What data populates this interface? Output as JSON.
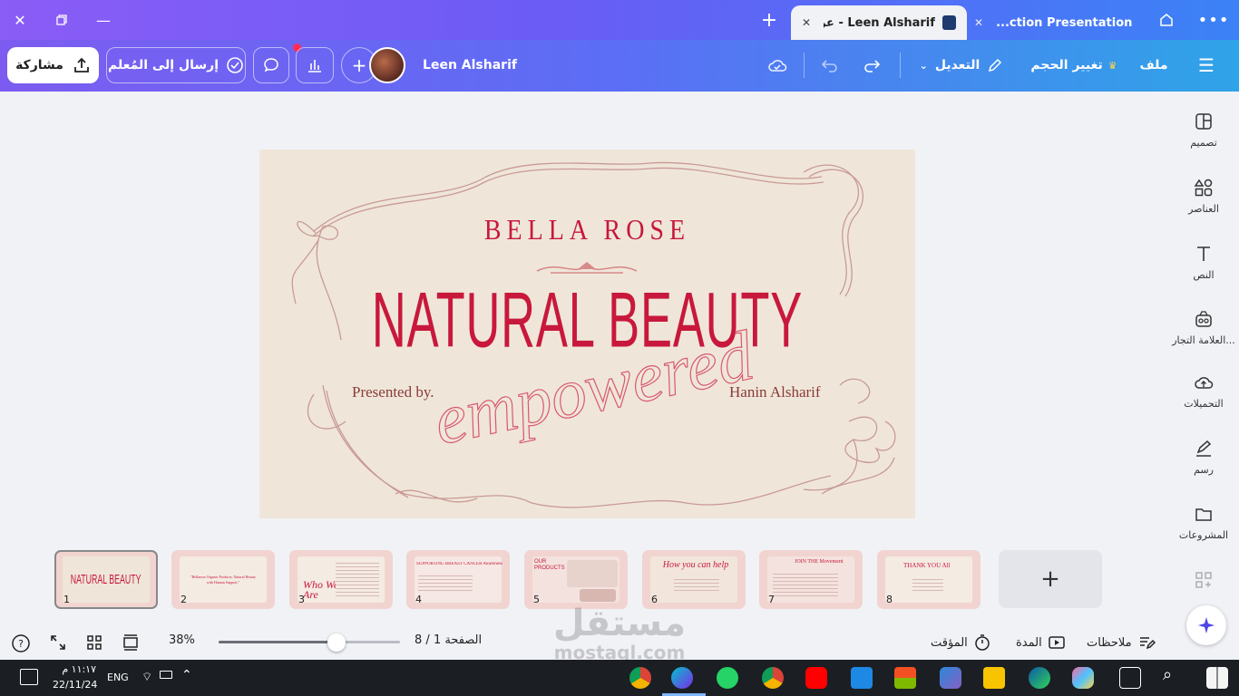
{
  "window": {
    "tabs": [
      {
        "label": "Leen Alsharif - عر..."
      },
      {
        "label": "...ction Presentation"
      }
    ]
  },
  "toolbar": {
    "share_label": "مشاركة",
    "send_label": "إرسال إلى المُعلم",
    "user_name": "Leen Alsharif",
    "edit_label": "التعديل",
    "resize_label": "تغيير الحجم",
    "file_label": "ملف"
  },
  "sidebar": {
    "items": [
      {
        "label": "تصميم",
        "icon": "layout-icon"
      },
      {
        "label": "العناصر",
        "icon": "elements-icon"
      },
      {
        "label": "النص",
        "icon": "text-icon"
      },
      {
        "label": "العلامة التجار...",
        "icon": "brand-icon"
      },
      {
        "label": "التحميلات",
        "icon": "upload-icon"
      },
      {
        "label": "رسم",
        "icon": "draw-icon"
      },
      {
        "label": "المشروعات",
        "icon": "folder-icon"
      }
    ]
  },
  "slide": {
    "brand": "BELLA ROSE",
    "title": "NATURAL BEAUTY",
    "script": "empowered",
    "presented_by": "Presented by.",
    "presenter": "Hanin Alsharif",
    "colors": {
      "bg": "#efe6d9",
      "accent": "#c8183c",
      "line": "#c99a96"
    }
  },
  "thumbnails": [
    {
      "num": "1",
      "title": "NATURAL BEAUTY",
      "active": true
    },
    {
      "num": "2",
      "title": "\"Bellarose Organic Products: Natural Beauty with Human Support.\""
    },
    {
      "num": "3",
      "title": "Who We Are"
    },
    {
      "num": "4",
      "title": "SUPPORTING BREAST CANCER Awareness"
    },
    {
      "num": "5",
      "title": "OUR PRODUCTS"
    },
    {
      "num": "6",
      "title": "How you can help"
    },
    {
      "num": "7",
      "title": "JOIN THE Movement"
    },
    {
      "num": "8",
      "title": "THANK YOU All"
    }
  ],
  "footer": {
    "notes_label": "ملاحظات",
    "duration_label": "المدة",
    "timer_label": "المؤقت",
    "page_label": "الصفحة 1 / 8",
    "zoom_label": "38%",
    "zoom_value": 0.38
  },
  "watermark": {
    "ar": "مستقل",
    "en": "mostaql.com"
  },
  "taskbar": {
    "time": "١١:١٧ م",
    "date": "22/11/24",
    "lang": "ENG"
  }
}
